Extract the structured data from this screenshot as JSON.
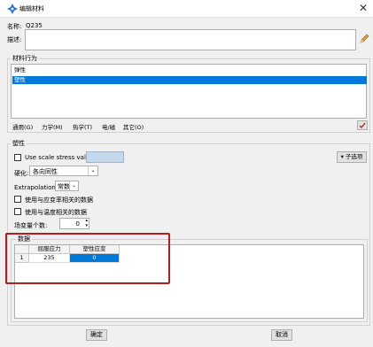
{
  "window": {
    "title": "编辑材料",
    "app_icon": "abaqus-cross-icon",
    "close_glyph": "✕"
  },
  "name": {
    "label": "名称:",
    "value": "Q235"
  },
  "description": {
    "label": "描述:",
    "value": "",
    "edit_icon": "pencil-icon"
  },
  "material_behaviors": {
    "group_title": "材料行为",
    "items": [
      {
        "label": "弹性"
      },
      {
        "label": "塑性",
        "selected": true
      }
    ]
  },
  "menu": {
    "items": [
      "通用(G)",
      "力学(M)",
      "热学(T)",
      "电/磁",
      "其它(O)"
    ],
    "delete_icon": "delete-icon"
  },
  "plasticity": {
    "group_title": "塑性",
    "use_scale_label": "Use scale stress value:",
    "use_scale_value": "",
    "hardening_label": "硬化:",
    "hardening_value": "各向同性",
    "suboptions_label": "子选项",
    "extrapolation_label": "Extrapolation:",
    "extrapolation_value": "常数",
    "strain_rate_label": "使用与应变率相关的数据",
    "temperature_label": "使用与温度相关的数据",
    "field_vars_label": "场变量个数:",
    "field_vars_value": "0"
  },
  "data_table": {
    "title": "数据",
    "columns": [
      "屈服应力",
      "塑性应变"
    ],
    "rows": [
      {
        "index": "1",
        "values": [
          "235",
          "0"
        ]
      }
    ],
    "selected_cell": "0"
  },
  "footer": {
    "ok_label": "确定",
    "cancel_label": "取消"
  },
  "accent_colors": {
    "selection": "#0078d7",
    "annotation_box": "#b21e1e"
  }
}
